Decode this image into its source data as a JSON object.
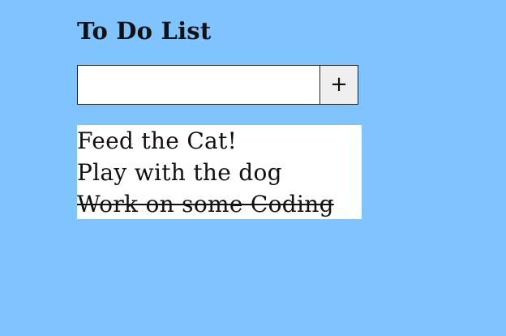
{
  "app": {
    "title": "To Do List",
    "background_color": "#80c4ff"
  },
  "add_form": {
    "input_value": "",
    "input_placeholder": "",
    "add_button_label": "+"
  },
  "todos": [
    {
      "text": "Feed the Cat!",
      "completed": false
    },
    {
      "text": "Play with the dog",
      "completed": false
    },
    {
      "text": "Work on some Coding",
      "completed": true
    }
  ]
}
